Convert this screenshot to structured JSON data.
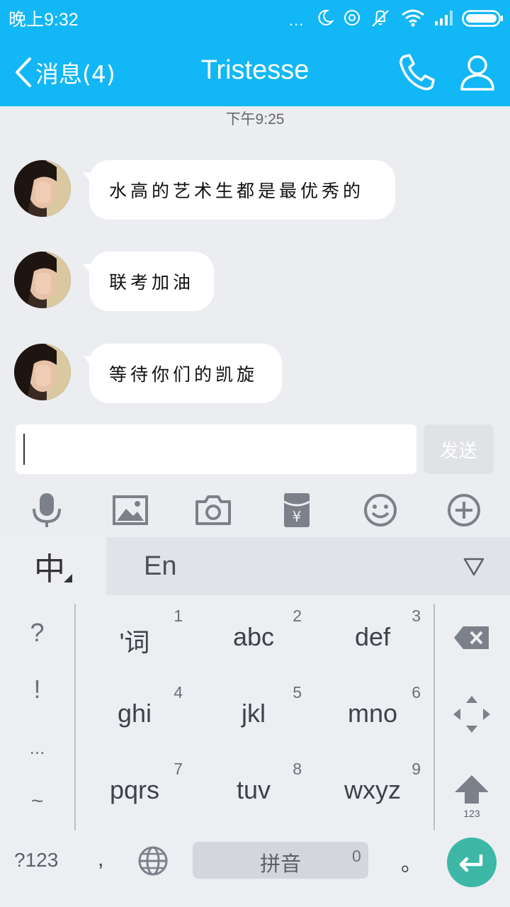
{
  "status_bar": {
    "time": "晚上9:32",
    "dots": "..."
  },
  "header": {
    "back_label": "消息(4)",
    "title": "Tristesse"
  },
  "chat": {
    "timestamp": "下午9:25",
    "messages": [
      {
        "text": "水高的艺术生都是最优秀的"
      },
      {
        "text": "联考加油"
      },
      {
        "text": "等待你们的凯旋"
      }
    ]
  },
  "composer": {
    "input_value": "",
    "send_label": "发送"
  },
  "toolbar": {
    "icons": [
      "microphone-icon",
      "image-icon",
      "camera-icon",
      "red-packet-icon",
      "emoji-icon",
      "plus-icon"
    ]
  },
  "keyboard": {
    "mode_zh": "中",
    "mode_en": "En",
    "symbols": [
      "?",
      "!",
      "...",
      "~"
    ],
    "keys": [
      {
        "label": "'词",
        "num": "1"
      },
      {
        "label": "abc",
        "num": "2"
      },
      {
        "label": "def",
        "num": "3"
      },
      {
        "label": "ghi",
        "num": "4"
      },
      {
        "label": "jkl",
        "num": "5"
      },
      {
        "label": "mno",
        "num": "6"
      },
      {
        "label": "pqrs",
        "num": "7"
      },
      {
        "label": "tuv",
        "num": "8"
      },
      {
        "label": "wxyz",
        "num": "9"
      }
    ],
    "shift_label": "123",
    "num_switch": "?123",
    "comma": ",",
    "space_label": "拼音",
    "space_num": "0",
    "period": "。"
  },
  "colors": {
    "accent": "#12b7f5",
    "enter": "#3db8a6",
    "background": "#ebedf0"
  }
}
